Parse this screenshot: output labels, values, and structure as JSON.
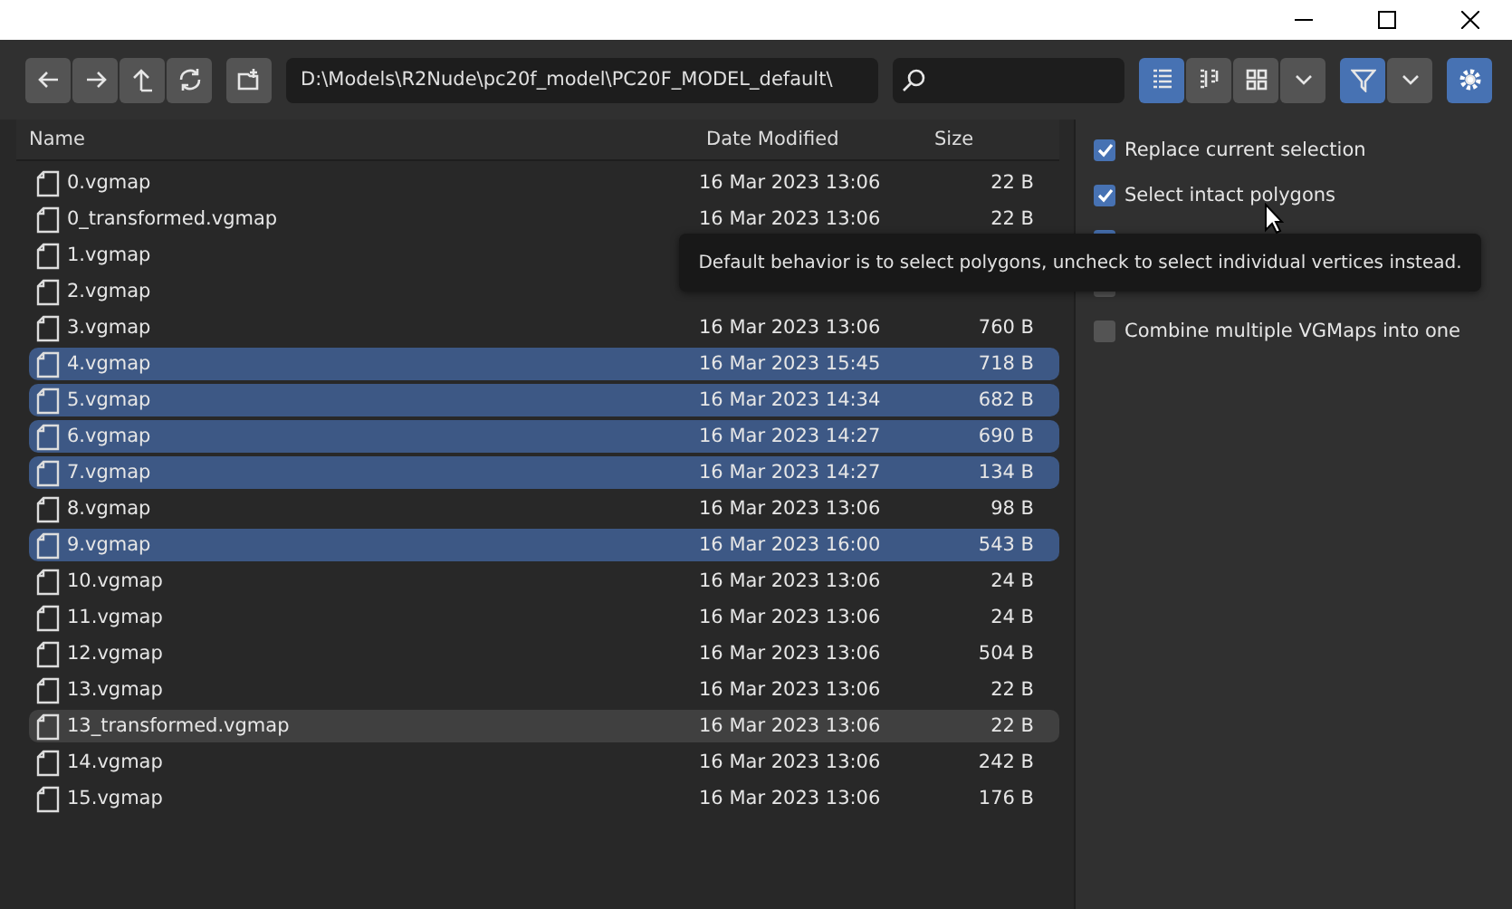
{
  "toolbar": {
    "path": "D:\\Models\\R2Nude\\pc20f_model\\PC20F_MODEL_default\\",
    "view_modes": [
      {
        "kind": "list",
        "selected": true
      },
      {
        "kind": "columns",
        "selected": false
      },
      {
        "kind": "grid",
        "selected": false
      }
    ],
    "filter_on": true
  },
  "table": {
    "columns": [
      "Name",
      "Date Modified",
      "Size"
    ],
    "rows": [
      {
        "name": "0.vgmap",
        "date": "16 Mar 2023 13:06",
        "size": "22 B",
        "selected": false,
        "hovered": false
      },
      {
        "name": "0_transformed.vgmap",
        "date": "16 Mar 2023 13:06",
        "size": "22 B",
        "selected": false,
        "hovered": false
      },
      {
        "name": "1.vgmap",
        "selected": false,
        "hovered": false
      },
      {
        "name": "2.vgmap",
        "selected": false,
        "hovered": false
      },
      {
        "name": "3.vgmap",
        "date": "16 Mar 2023 13:06",
        "size": "760 B",
        "selected": false,
        "hovered": false
      },
      {
        "name": "4.vgmap",
        "date": "16 Mar 2023 15:45",
        "size": "718 B",
        "selected": true,
        "hovered": false
      },
      {
        "name": "5.vgmap",
        "date": "16 Mar 2023 14:34",
        "size": "682 B",
        "selected": true,
        "hovered": false
      },
      {
        "name": "6.vgmap",
        "date": "16 Mar 2023 14:27",
        "size": "690 B",
        "selected": true,
        "hovered": false
      },
      {
        "name": "7.vgmap",
        "date": "16 Mar 2023 14:27",
        "size": "134 B",
        "selected": true,
        "hovered": false
      },
      {
        "name": "8.vgmap",
        "date": "16 Mar 2023 13:06",
        "size": "98 B",
        "selected": false,
        "hovered": false
      },
      {
        "name": "9.vgmap",
        "date": "16 Mar 2023 16:00",
        "size": "543 B",
        "selected": true,
        "hovered": false
      },
      {
        "name": "10.vgmap",
        "date": "16 Mar 2023 13:06",
        "size": "24 B",
        "selected": false,
        "hovered": false
      },
      {
        "name": "11.vgmap",
        "date": "16 Mar 2023 13:06",
        "size": "24 B",
        "selected": false,
        "hovered": false
      },
      {
        "name": "12.vgmap",
        "date": "16 Mar 2023 13:06",
        "size": "504 B",
        "selected": false,
        "hovered": false
      },
      {
        "name": "13.vgmap",
        "date": "16 Mar 2023 13:06",
        "size": "22 B",
        "selected": false,
        "hovered": false
      },
      {
        "name": "13_transformed.vgmap",
        "date": "16 Mar 2023 13:06",
        "size": "22 B",
        "selected": false,
        "hovered": true
      },
      {
        "name": "14.vgmap",
        "date": "16 Mar 2023 13:06",
        "size": "242 B",
        "selected": false,
        "hovered": false
      },
      {
        "name": "15.vgmap",
        "date": "16 Mar 2023 13:06",
        "size": "176 B",
        "selected": false,
        "hovered": false
      }
    ]
  },
  "options": [
    {
      "label": "Replace current selection",
      "checked": true
    },
    {
      "label": "Select intact polygons",
      "checked": true
    },
    {
      "checked": true
    },
    {
      "checked": false
    },
    {
      "label": "Combine multiple VGMaps into one",
      "checked": false
    }
  ],
  "tooltip": "Default behavior is to select polygons, uncheck to select individual vertices instead."
}
